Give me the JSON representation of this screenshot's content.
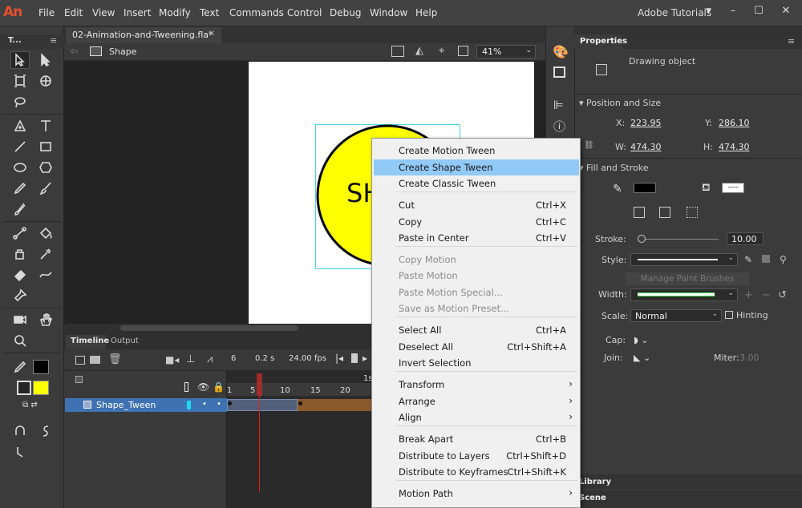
{
  "app": {
    "logo": "An",
    "workspace": "Adobe Tutorials"
  },
  "menubar": [
    "File",
    "Edit",
    "View",
    "Insert",
    "Modify",
    "Text",
    "Commands",
    "Control",
    "Debug",
    "Window",
    "Help"
  ],
  "window_controls": {
    "minimize": "–",
    "maximize": "☐",
    "close": "✕"
  },
  "tools_panel": {
    "title": "T..."
  },
  "document": {
    "tab_title": "02-Animation-and-Tweening.fla*",
    "close": "✕",
    "scene_label": "Shape",
    "zoom": "41%"
  },
  "stage": {
    "text": "SH"
  },
  "timeline": {
    "tab": "Timeline",
    "output_tab": "Output",
    "frame": "6",
    "time": "0.2",
    "time_unit": "s",
    "fps": "24.00",
    "fps_unit": "fps",
    "ruler": [
      "1",
      "5",
      "10",
      "15",
      "20",
      "1s"
    ],
    "layer_name": "Shape_Tween"
  },
  "properties": {
    "tab": "Properties",
    "object_type": "Drawing object",
    "position_section": "Position and Size",
    "x_label": "X:",
    "x": "223.95",
    "y_label": "Y:",
    "y": "286.10",
    "w_label": "W:",
    "w": "474.30",
    "h_label": "H:",
    "h": "474.30",
    "fill_section": "Fill and Stroke",
    "stroke_label": "Stroke:",
    "stroke": "10.00",
    "style_label": "Style:",
    "manage_brushes": "Manage Paint Brushes",
    "width_label": "Width:",
    "scale_label": "Scale:",
    "scale": "Normal",
    "hinting": "Hinting",
    "cap_label": "Cap:",
    "join_label": "Join:",
    "miter_label": "Miter:",
    "miter": "3.00",
    "stroke_color": "#000000",
    "fill_color": "#ffff00"
  },
  "bottom_tabs": {
    "library": "Library",
    "scene": "Scene"
  },
  "context_menu": {
    "items": [
      {
        "label": "Create Motion Tween",
        "shortcut": "",
        "state": "normal"
      },
      {
        "label": "Create Shape Tween",
        "shortcut": "",
        "state": "highlight"
      },
      {
        "label": "Create Classic Tween",
        "shortcut": "",
        "state": "normal"
      },
      {
        "label": "Cut",
        "shortcut": "Ctrl+X",
        "state": "normal"
      },
      {
        "label": "Copy",
        "shortcut": "Ctrl+C",
        "state": "normal"
      },
      {
        "label": "Paste in Center",
        "shortcut": "Ctrl+V",
        "state": "normal"
      },
      {
        "label": "Copy Motion",
        "shortcut": "",
        "state": "disabled"
      },
      {
        "label": "Paste Motion",
        "shortcut": "",
        "state": "disabled"
      },
      {
        "label": "Paste Motion Special...",
        "shortcut": "",
        "state": "disabled"
      },
      {
        "label": "Save as Motion Preset...",
        "shortcut": "",
        "state": "disabled"
      },
      {
        "label": "Select All",
        "shortcut": "Ctrl+A",
        "state": "normal"
      },
      {
        "label": "Deselect All",
        "shortcut": "Ctrl+Shift+A",
        "state": "normal"
      },
      {
        "label": "Invert Selection",
        "shortcut": "",
        "state": "normal"
      },
      {
        "label": "Transform",
        "shortcut": "›",
        "state": "normal"
      },
      {
        "label": "Arrange",
        "shortcut": "›",
        "state": "normal"
      },
      {
        "label": "Align",
        "shortcut": "›",
        "state": "normal"
      },
      {
        "label": "Break Apart",
        "shortcut": "Ctrl+B",
        "state": "normal"
      },
      {
        "label": "Distribute to Layers",
        "shortcut": "Ctrl+Shift+D",
        "state": "normal"
      },
      {
        "label": "Distribute to Keyframes",
        "shortcut": "Ctrl+Shift+K",
        "state": "normal"
      },
      {
        "label": "Motion Path",
        "shortcut": "›",
        "state": "normal"
      }
    ]
  }
}
